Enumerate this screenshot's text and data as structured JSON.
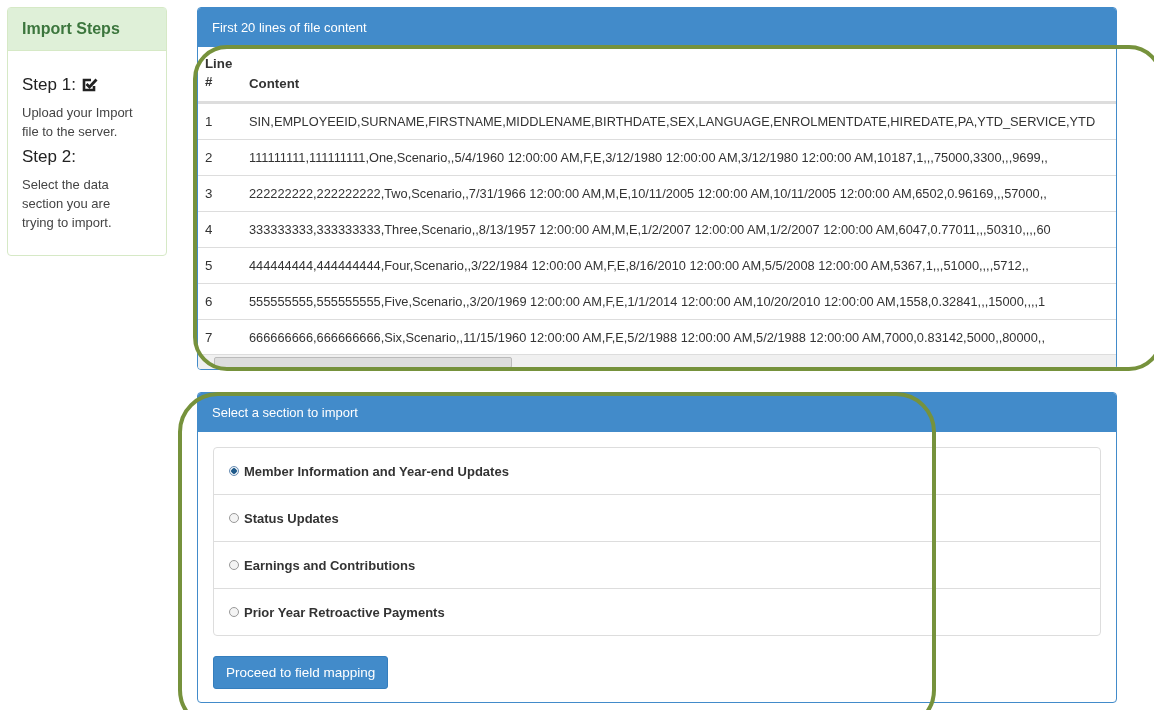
{
  "sidebar": {
    "title": "Import Steps",
    "steps": [
      {
        "heading": "Step 1:",
        "done": true,
        "text": "Upload your Import file to the server."
      },
      {
        "heading": "Step 2:",
        "done": false,
        "text": "Select the data section you are trying to import."
      }
    ]
  },
  "preview": {
    "title": "First 20 lines of file content",
    "columns": [
      "Line #",
      "Content"
    ],
    "rows": [
      {
        "line": "1",
        "content": "SIN,EMPLOYEEID,SURNAME,FIRSTNAME,MIDDLENAME,BIRTHDATE,SEX,LANGUAGE,ENROLMENTDATE,HIREDATE,PA,YTD_SERVICE,YTD"
      },
      {
        "line": "2",
        "content": "111111111,111111111,One,Scenario,,5/4/1960 12:00:00 AM,F,E,3/12/1980 12:00:00 AM,3/12/1980 12:00:00 AM,10187,1,,,75000,3300,,,9699,,"
      },
      {
        "line": "3",
        "content": "222222222,222222222,Two,Scenario,,7/31/1966 12:00:00 AM,M,E,10/11/2005 12:00:00 AM,10/11/2005 12:00:00 AM,6502,0.96169,,,57000,,"
      },
      {
        "line": "4",
        "content": "333333333,333333333,Three,Scenario,,8/13/1957 12:00:00 AM,M,E,1/2/2007 12:00:00 AM,1/2/2007 12:00:00 AM,6047,0.77011,,,50310,,,,60"
      },
      {
        "line": "5",
        "content": "444444444,444444444,Four,Scenario,,3/22/1984 12:00:00 AM,F,E,8/16/2010 12:00:00 AM,5/5/2008 12:00:00 AM,5367,1,,,51000,,,,5712,,"
      },
      {
        "line": "6",
        "content": "555555555,555555555,Five,Scenario,,3/20/1969 12:00:00 AM,F,E,1/1/2014 12:00:00 AM,10/20/2010 12:00:00 AM,1558,0.32841,,,15000,,,,1"
      },
      {
        "line": "7",
        "content": "666666666,666666666,Six,Scenario,,11/15/1960 12:00:00 AM,F,E,5/2/1988 12:00:00 AM,5/2/1988 12:00:00 AM,7000,0.83142,5000,,80000,,"
      }
    ]
  },
  "section_picker": {
    "title": "Select a section to import",
    "options": [
      {
        "label": "Member Information and Year-end Updates",
        "selected": true
      },
      {
        "label": "Status Updates",
        "selected": false
      },
      {
        "label": "Earnings and Contributions",
        "selected": false
      },
      {
        "label": "Prior Year Retroactive Payments",
        "selected": false
      }
    ],
    "button": "Proceed to field mapping"
  }
}
